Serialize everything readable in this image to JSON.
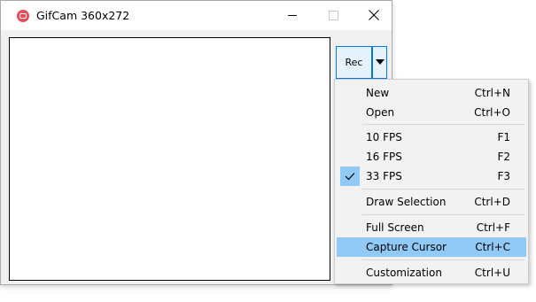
{
  "window": {
    "title": "GifCam 360x272"
  },
  "icons": {
    "app": "gifcam-app-icon",
    "minimize": "minimize-icon",
    "maximize": "maximize-icon",
    "close": "close-icon",
    "dropdown": "chevron-down-icon",
    "check": "checkmark-icon"
  },
  "toolbar": {
    "rec_label": "Rec"
  },
  "menu": {
    "items": [
      {
        "label": "New",
        "shortcut": "Ctrl+N"
      },
      {
        "label": "Open",
        "shortcut": "Ctrl+O"
      },
      {
        "label": "10 FPS",
        "shortcut": "F1"
      },
      {
        "label": "16 FPS",
        "shortcut": "F2"
      },
      {
        "label": "33 FPS",
        "shortcut": "F3",
        "checked": true
      },
      {
        "label": "Draw Selection",
        "shortcut": "Ctrl+D"
      },
      {
        "label": "Full Screen",
        "shortcut": "Ctrl+F"
      },
      {
        "label": "Capture Cursor",
        "shortcut": "Ctrl+C",
        "highlighted": true
      },
      {
        "label": "Customization",
        "shortcut": "Ctrl+U"
      }
    ]
  },
  "colors": {
    "highlight": "#91c9f7",
    "accent_border": "#0078d7",
    "app_icon": "#e84d5b"
  }
}
